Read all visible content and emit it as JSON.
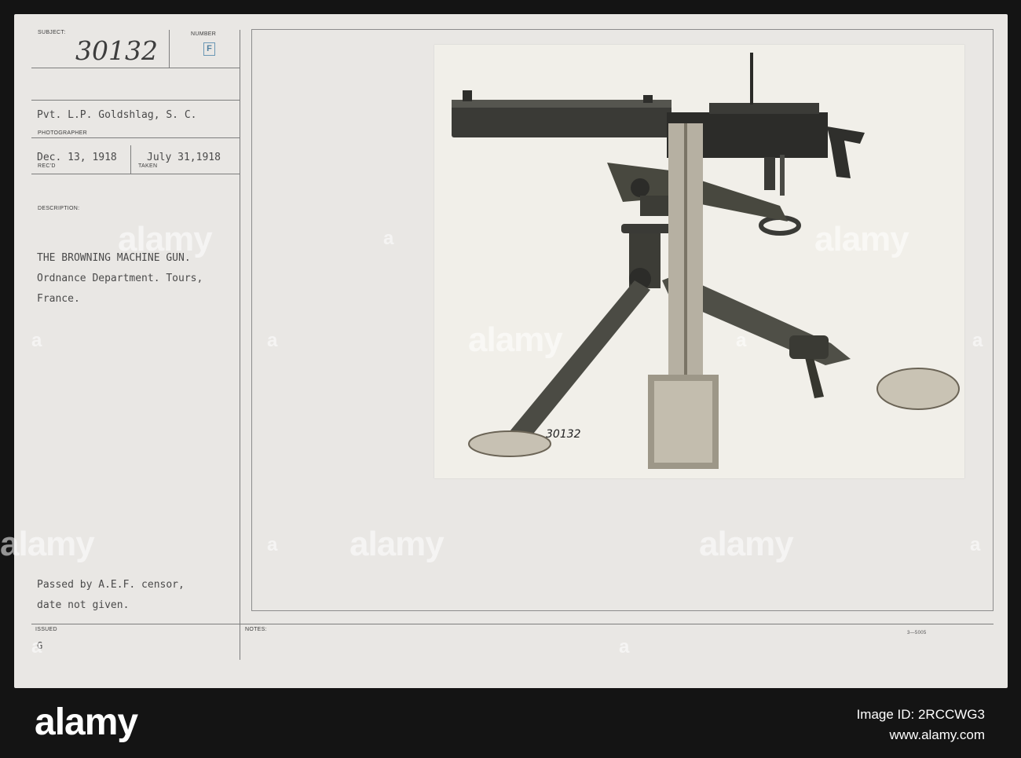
{
  "card": {
    "subject_label": "SUBJECT:",
    "subject_number": "30132",
    "number_label": "NUMBER",
    "number_stamp": "F",
    "photographer_name": "Pvt. L.P. Goldshlag, S. C.",
    "photographer_label": "PHOTOGRAPHER",
    "recd_date": "Dec. 13, 1918",
    "recd_label": "REC'D",
    "taken_date": "July 31,1918",
    "taken_label": "TAKEN",
    "description_label": "DESCRIPTION:",
    "description_lines": [
      "THE BROWNING MACHINE GUN.",
      "Ordnance Department. Tours,",
      "France."
    ],
    "censor_lines": [
      "Passed by A.E.F. censor,",
      "date not given."
    ],
    "issued_label": "ISSUED",
    "issued_value": "G",
    "notes_label": "NOTES:",
    "form_code": "3—5005",
    "photo_negative_number": "30132"
  },
  "watermark": {
    "brand": "alamy",
    "letter": "a"
  },
  "footer": {
    "logo": "alamy",
    "image_id": "Image ID: 2RCCWG3",
    "url": "www.alamy.com"
  }
}
